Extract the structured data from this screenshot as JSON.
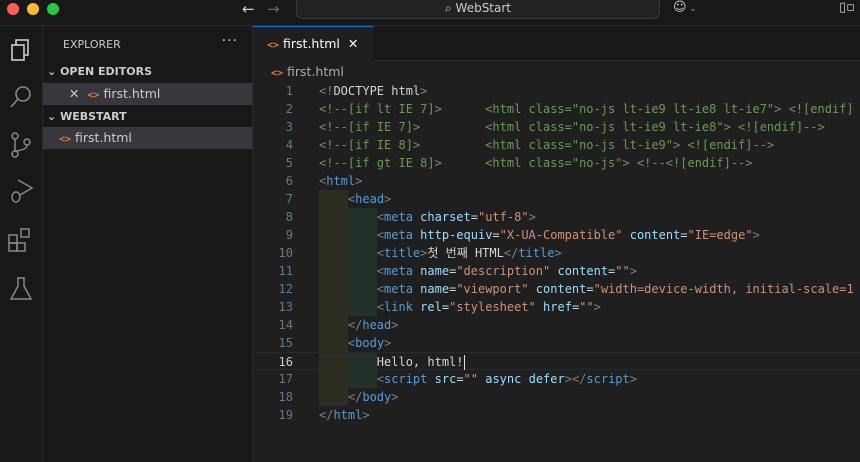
{
  "window": {
    "title": "WebStart",
    "traffic_colors": [
      "#ff5f57",
      "#febc2e",
      "#28c840"
    ]
  },
  "explorer": {
    "title": "EXPLORER",
    "more": "···",
    "open_editors": {
      "label": "OPEN EDITORS",
      "items": [
        {
          "name": "first.html"
        }
      ]
    },
    "workspace": {
      "label": "WEBSTART",
      "items": [
        {
          "name": "first.html"
        }
      ]
    }
  },
  "tabs": [
    {
      "label": "first.html",
      "active": true
    }
  ],
  "breadcrumb": "first.html",
  "editor": {
    "current_line": 16,
    "lines": [
      [
        [
          "b",
          "<!"
        ],
        [
          "p",
          "DOCTYPE html"
        ],
        [
          "b",
          ">"
        ]
      ],
      [
        [
          "c",
          "<!--[if lt IE 7]>      <html class=\"no-js lt-ie9 lt-ie8 lt-ie7\"> <![endif]"
        ]
      ],
      [
        [
          "c",
          "<!--[if IE 7]>         <html class=\"no-js lt-ie9 lt-ie8\"> <![endif]-->"
        ]
      ],
      [
        [
          "c",
          "<!--[if IE 8]>         <html class=\"no-js lt-ie9\"> <![endif]-->"
        ]
      ],
      [
        [
          "c",
          "<!--[if gt IE 8]>      <html class=\"no-js\"> <!"
        ],
        [
          "r",
          "--"
        ],
        [
          "c",
          "<![endif]-->"
        ]
      ],
      [
        [
          "b",
          "<"
        ],
        [
          "t",
          "html"
        ],
        [
          "b",
          ">"
        ]
      ],
      [
        [
          "p",
          "    "
        ],
        [
          "b",
          "<"
        ],
        [
          "t",
          "head"
        ],
        [
          "b",
          ">"
        ]
      ],
      [
        [
          "p",
          "        "
        ],
        [
          "b",
          "<"
        ],
        [
          "t",
          "meta"
        ],
        [
          "p",
          " "
        ],
        [
          "a",
          "charset"
        ],
        [
          "p",
          "="
        ],
        [
          "s",
          "\"utf-8\""
        ],
        [
          "b",
          ">"
        ]
      ],
      [
        [
          "p",
          "        "
        ],
        [
          "b",
          "<"
        ],
        [
          "t",
          "meta"
        ],
        [
          "p",
          " "
        ],
        [
          "a",
          "http-equiv"
        ],
        [
          "p",
          "="
        ],
        [
          "s",
          "\"X-UA-Compatible\""
        ],
        [
          "p",
          " "
        ],
        [
          "a",
          "content"
        ],
        [
          "p",
          "="
        ],
        [
          "s",
          "\"IE=edge\""
        ],
        [
          "b",
          ">"
        ]
      ],
      [
        [
          "p",
          "        "
        ],
        [
          "b",
          "<"
        ],
        [
          "t",
          "title"
        ],
        [
          "b",
          ">"
        ],
        [
          "p",
          "첫 번째 HTML"
        ],
        [
          "b",
          "</"
        ],
        [
          "t",
          "title"
        ],
        [
          "b",
          ">"
        ]
      ],
      [
        [
          "p",
          "        "
        ],
        [
          "b",
          "<"
        ],
        [
          "t",
          "meta"
        ],
        [
          "p",
          " "
        ],
        [
          "a",
          "name"
        ],
        [
          "p",
          "="
        ],
        [
          "s",
          "\"description\""
        ],
        [
          "p",
          " "
        ],
        [
          "a",
          "content"
        ],
        [
          "p",
          "="
        ],
        [
          "s",
          "\"\""
        ],
        [
          "b",
          ">"
        ]
      ],
      [
        [
          "p",
          "        "
        ],
        [
          "b",
          "<"
        ],
        [
          "t",
          "meta"
        ],
        [
          "p",
          " "
        ],
        [
          "a",
          "name"
        ],
        [
          "p",
          "="
        ],
        [
          "s",
          "\"viewport\""
        ],
        [
          "p",
          " "
        ],
        [
          "a",
          "content"
        ],
        [
          "p",
          "="
        ],
        [
          "s",
          "\"width=device-width, initial-scale=1"
        ]
      ],
      [
        [
          "p",
          "        "
        ],
        [
          "b",
          "<"
        ],
        [
          "t",
          "link"
        ],
        [
          "p",
          " "
        ],
        [
          "a",
          "rel"
        ],
        [
          "p",
          "="
        ],
        [
          "s",
          "\"stylesheet\""
        ],
        [
          "p",
          " "
        ],
        [
          "a",
          "href"
        ],
        [
          "p",
          "="
        ],
        [
          "s",
          "\"\""
        ],
        [
          "b",
          ">"
        ]
      ],
      [
        [
          "p",
          "    "
        ],
        [
          "b",
          "</"
        ],
        [
          "t",
          "head"
        ],
        [
          "b",
          ">"
        ]
      ],
      [
        [
          "p",
          "    "
        ],
        [
          "b",
          "<"
        ],
        [
          "t",
          "body"
        ],
        [
          "b",
          ">"
        ]
      ],
      [
        [
          "p",
          "        Hello, html!"
        ]
      ],
      [
        [
          "p",
          "        "
        ],
        [
          "b",
          "<"
        ],
        [
          "t",
          "script"
        ],
        [
          "p",
          " "
        ],
        [
          "a",
          "src"
        ],
        [
          "p",
          "="
        ],
        [
          "s",
          "\"\""
        ],
        [
          "p",
          " "
        ],
        [
          "a",
          "async"
        ],
        [
          "p",
          " "
        ],
        [
          "a",
          "defer"
        ],
        [
          "b",
          "></"
        ],
        [
          "t",
          "script"
        ],
        [
          "b",
          ">"
        ]
      ],
      [
        [
          "p",
          "    "
        ],
        [
          "b",
          "</"
        ],
        [
          "t",
          "body"
        ],
        [
          "b",
          ">"
        ]
      ],
      [
        [
          "b",
          "</"
        ],
        [
          "t",
          "html"
        ],
        [
          "b",
          ">"
        ]
      ]
    ]
  }
}
